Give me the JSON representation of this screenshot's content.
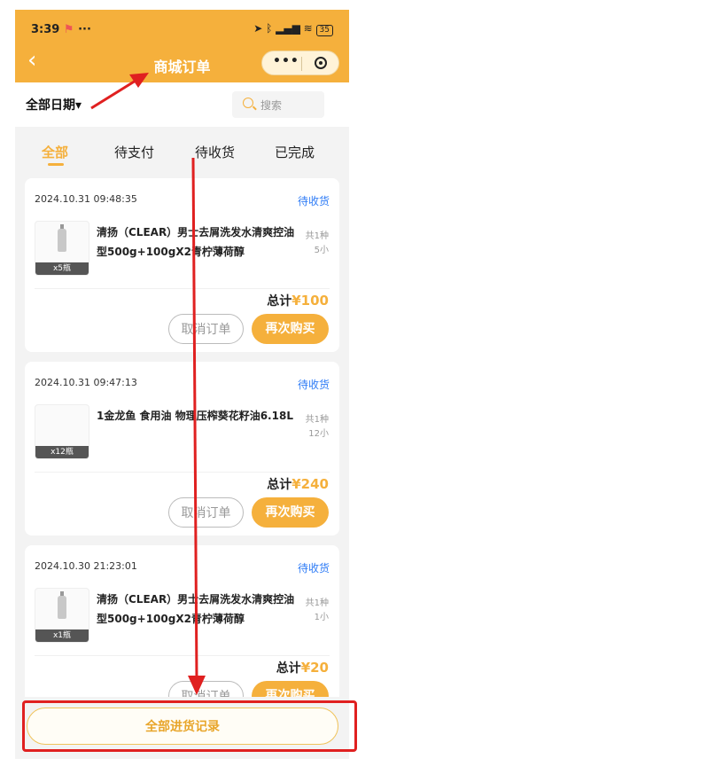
{
  "status": {
    "time": "3:39",
    "battery": "35"
  },
  "header": {
    "title": "商城订单"
  },
  "filter": {
    "date": "全部日期▾",
    "search_placeholder": "搜索"
  },
  "tabs": [
    {
      "label": "全部"
    },
    {
      "label": "待支付"
    },
    {
      "label": "待收货"
    },
    {
      "label": "已完成"
    }
  ],
  "orders": [
    {
      "date": "2024.10.31 09:48:35",
      "status": "待收货",
      "product": "清扬（CLEAR）男士去屑洗发水清爽控油型500g+100gX2青柠薄荷醇",
      "qty": "x5瓶",
      "kinds": "共1种",
      "units": "5小",
      "total_label": "总计",
      "total_price": "¥100",
      "cancel_label": "取消订单",
      "buy_label": "再次购买"
    },
    {
      "date": "2024.10.31 09:47:13",
      "status": "待收货",
      "product": "1金龙鱼 食用油 物理压榨葵花籽油6.18L",
      "qty": "x12瓶",
      "kinds": "共1种",
      "units": "12小",
      "total_label": "总计",
      "total_price": "¥240",
      "cancel_label": "取消订单",
      "buy_label": "再次购买"
    },
    {
      "date": "2024.10.30 21:23:01",
      "status": "待收货",
      "product": "清扬（CLEAR）男士去屑洗发水清爽控油型500g+100gX2青柠薄荷醇",
      "qty": "x1瓶",
      "kinds": "共1种",
      "units": "1小",
      "total_label": "总计",
      "total_price": "¥20",
      "cancel_label": "取消订单",
      "buy_label": "再次购买"
    }
  ],
  "bottom_button": {
    "label": "全部进货记录"
  },
  "colors": {
    "accent": "#f5b03c",
    "status_blue": "#2f7cf6",
    "annotation_red": "#e02020"
  }
}
